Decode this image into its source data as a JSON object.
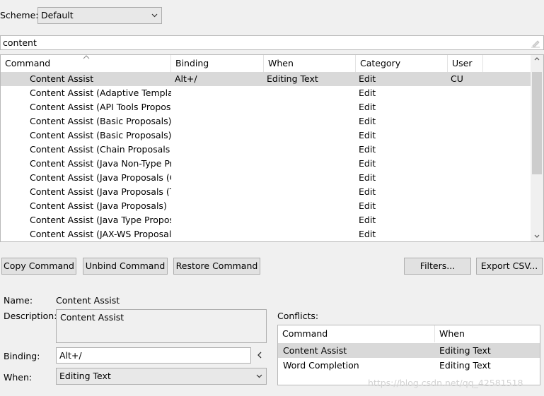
{
  "scheme": {
    "label": "Scheme:",
    "value": "Default"
  },
  "filter": {
    "value": "content"
  },
  "commands_table": {
    "columns": [
      "Command",
      "Binding",
      "When",
      "Category",
      "User"
    ],
    "rows": [
      {
        "command": "Content Assist",
        "binding": "Alt+/",
        "when": "Editing Text",
        "category": "Edit",
        "user": "CU",
        "selected": true
      },
      {
        "command": "Content Assist (Adaptive Template",
        "binding": "",
        "when": "",
        "category": "Edit",
        "user": ""
      },
      {
        "command": "Content Assist (API Tools Proposal",
        "binding": "",
        "when": "",
        "category": "Edit",
        "user": ""
      },
      {
        "command": "Content Assist (Basic Proposals)",
        "binding": "",
        "when": "",
        "category": "Edit",
        "user": ""
      },
      {
        "command": "Content Assist (Basic Proposals)",
        "binding": "",
        "when": "",
        "category": "Edit",
        "user": ""
      },
      {
        "command": "Content Assist (Chain Proposals (C",
        "binding": "",
        "when": "",
        "category": "Edit",
        "user": ""
      },
      {
        "command": "Content Assist (Java Non-Type Pro",
        "binding": "",
        "when": "",
        "category": "Edit",
        "user": ""
      },
      {
        "command": "Content Assist (Java Proposals (Co",
        "binding": "",
        "when": "",
        "category": "Edit",
        "user": ""
      },
      {
        "command": "Content Assist (Java Proposals (Ta",
        "binding": "",
        "when": "",
        "category": "Edit",
        "user": ""
      },
      {
        "command": "Content Assist (Java Proposals)",
        "binding": "",
        "when": "",
        "category": "Edit",
        "user": ""
      },
      {
        "command": "Content Assist (Java Type Proposa",
        "binding": "",
        "when": "",
        "category": "Edit",
        "user": ""
      },
      {
        "command": "Content Assist (JAX-WS Proposals)",
        "binding": "",
        "when": "",
        "category": "Edit",
        "user": ""
      }
    ]
  },
  "buttons": {
    "copy": "Copy Command",
    "unbind": "Unbind Command",
    "restore": "Restore Command",
    "filters": "Filters...",
    "export": "Export CSV..."
  },
  "details": {
    "name_label": "Name:",
    "name_value": "Content Assist",
    "description_label": "Description:",
    "description_value": "Content Assist",
    "binding_label": "Binding:",
    "binding_value": "Alt+/",
    "when_label": "When:",
    "when_value": "Editing Text"
  },
  "conflicts": {
    "label": "Conflicts:",
    "columns": [
      "Command",
      "When"
    ],
    "rows": [
      {
        "command": "Content Assist",
        "when": "Editing Text",
        "selected": true
      },
      {
        "command": "Word Completion",
        "when": "Editing Text"
      }
    ]
  },
  "watermark": "https://blog.csdn.net/qq_42581518",
  "colors": {
    "selected_row": "#d9d9d9",
    "background": "#f0f0f0"
  }
}
